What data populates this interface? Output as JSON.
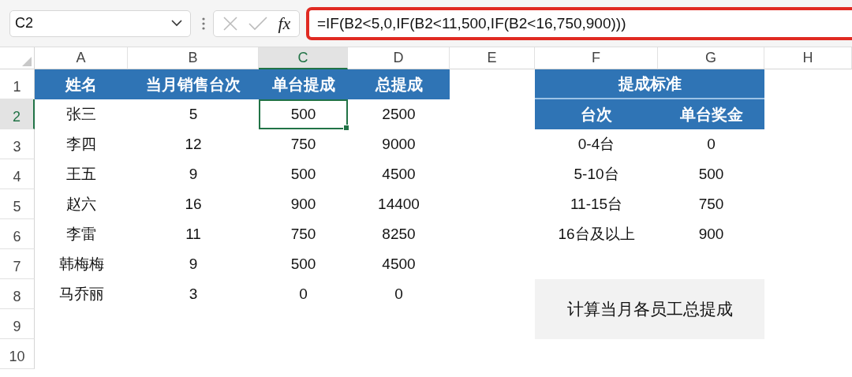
{
  "formula_bar": {
    "name_box": "C2",
    "function_label": "fx",
    "formula": "=IF(B2<5,0,IF(B2<11,500,IF(B2<16,750,900)))"
  },
  "columns": [
    {
      "label": "A",
      "selected": false
    },
    {
      "label": "B",
      "selected": false
    },
    {
      "label": "C",
      "selected": true
    },
    {
      "label": "D",
      "selected": false
    },
    {
      "label": "E",
      "selected": false
    },
    {
      "label": "F",
      "selected": false
    },
    {
      "label": "G",
      "selected": false
    },
    {
      "label": "H",
      "selected": false
    }
  ],
  "rows": [
    {
      "label": "1",
      "selected": false,
      "cells": [
        {
          "kind": "header",
          "text": "姓名"
        },
        {
          "kind": "header",
          "text": "当月销售台次"
        },
        {
          "kind": "header",
          "text": "单台提成"
        },
        {
          "kind": "header",
          "text": "总提成"
        },
        {
          "kind": "empty"
        },
        {
          "kind": "title",
          "text": "提成标准"
        },
        {
          "kind": "merged"
        }
      ]
    },
    {
      "label": "2",
      "selected": true,
      "cells": [
        {
          "kind": "value",
          "text": "张三"
        },
        {
          "kind": "value",
          "text": "5"
        },
        {
          "kind": "value",
          "text": "500",
          "selected": true
        },
        {
          "kind": "value",
          "text": "2500"
        },
        {
          "kind": "empty"
        },
        {
          "kind": "header",
          "text": "台次"
        },
        {
          "kind": "header",
          "text": "单台奖金"
        }
      ]
    },
    {
      "label": "3",
      "selected": false,
      "cells": [
        {
          "kind": "value",
          "text": "李四"
        },
        {
          "kind": "value",
          "text": "12"
        },
        {
          "kind": "value",
          "text": "750"
        },
        {
          "kind": "value",
          "text": "9000"
        },
        {
          "kind": "empty"
        },
        {
          "kind": "value",
          "text": "0-4台"
        },
        {
          "kind": "value",
          "text": "0"
        }
      ]
    },
    {
      "label": "4",
      "selected": false,
      "cells": [
        {
          "kind": "value",
          "text": "王五"
        },
        {
          "kind": "value",
          "text": "9"
        },
        {
          "kind": "value",
          "text": "500"
        },
        {
          "kind": "value",
          "text": "4500"
        },
        {
          "kind": "empty"
        },
        {
          "kind": "value",
          "text": "5-10台"
        },
        {
          "kind": "value",
          "text": "500"
        }
      ]
    },
    {
      "label": "5",
      "selected": false,
      "cells": [
        {
          "kind": "value",
          "text": "赵六"
        },
        {
          "kind": "value",
          "text": "16"
        },
        {
          "kind": "value",
          "text": "900"
        },
        {
          "kind": "value",
          "text": "14400"
        },
        {
          "kind": "empty"
        },
        {
          "kind": "value",
          "text": "11-15台"
        },
        {
          "kind": "value",
          "text": "750"
        }
      ]
    },
    {
      "label": "6",
      "selected": false,
      "cells": [
        {
          "kind": "value",
          "text": "李雷"
        },
        {
          "kind": "value",
          "text": "11"
        },
        {
          "kind": "value",
          "text": "750"
        },
        {
          "kind": "value",
          "text": "8250"
        },
        {
          "kind": "empty"
        },
        {
          "kind": "value",
          "text": "16台及以上"
        },
        {
          "kind": "value",
          "text": "900"
        }
      ]
    },
    {
      "label": "7",
      "selected": false,
      "cells": [
        {
          "kind": "value",
          "text": "韩梅梅"
        },
        {
          "kind": "value",
          "text": "9"
        },
        {
          "kind": "value",
          "text": "500"
        },
        {
          "kind": "value",
          "text": "4500"
        }
      ]
    },
    {
      "label": "8",
      "selected": false,
      "cells": [
        {
          "kind": "value",
          "text": "马乔丽"
        },
        {
          "kind": "value",
          "text": "3"
        },
        {
          "kind": "value",
          "text": "0"
        },
        {
          "kind": "value",
          "text": "0"
        }
      ]
    },
    {
      "label": "9",
      "selected": false
    },
    {
      "label": "10",
      "selected": false
    }
  ],
  "note_box": {
    "text": "计算当月各员工总提成"
  }
}
